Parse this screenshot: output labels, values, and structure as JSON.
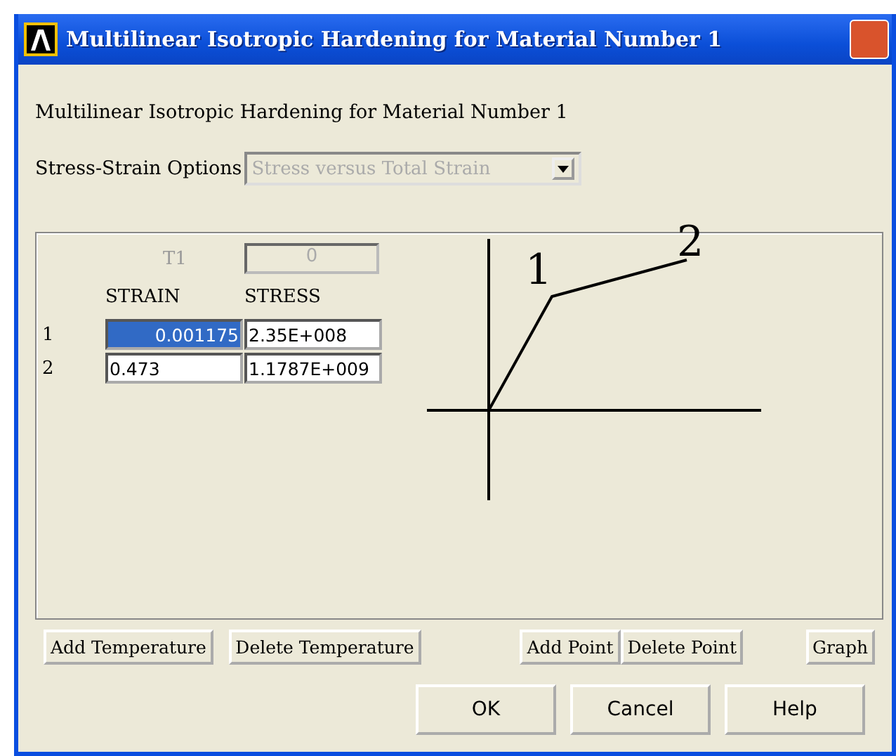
{
  "window": {
    "title": "Multilinear Isotropic Hardening for Material Number 1"
  },
  "heading": "Multilinear Isotropic Hardening for Material Number 1",
  "options": {
    "label": "Stress-Strain Options",
    "value": "Stress versus Total Strain",
    "disabled": true
  },
  "table": {
    "temperature_label": "T1",
    "temperature_value": "0",
    "columns": [
      "STRAIN",
      "STRESS"
    ],
    "rows": [
      {
        "index": "1",
        "strain": "0.001175",
        "stress": "2.35E+008",
        "selected": true
      },
      {
        "index": "2",
        "strain": "0.473",
        "stress": "1.1787E+009",
        "selected": false
      }
    ]
  },
  "diagram": {
    "point_labels": [
      "1",
      "2"
    ]
  },
  "table_buttons": [
    "Add Temperature",
    "Delete Temperature",
    "Add Point",
    "Delete Point",
    "Graph"
  ],
  "buttons": [
    "OK",
    "Cancel",
    "Help"
  ]
}
